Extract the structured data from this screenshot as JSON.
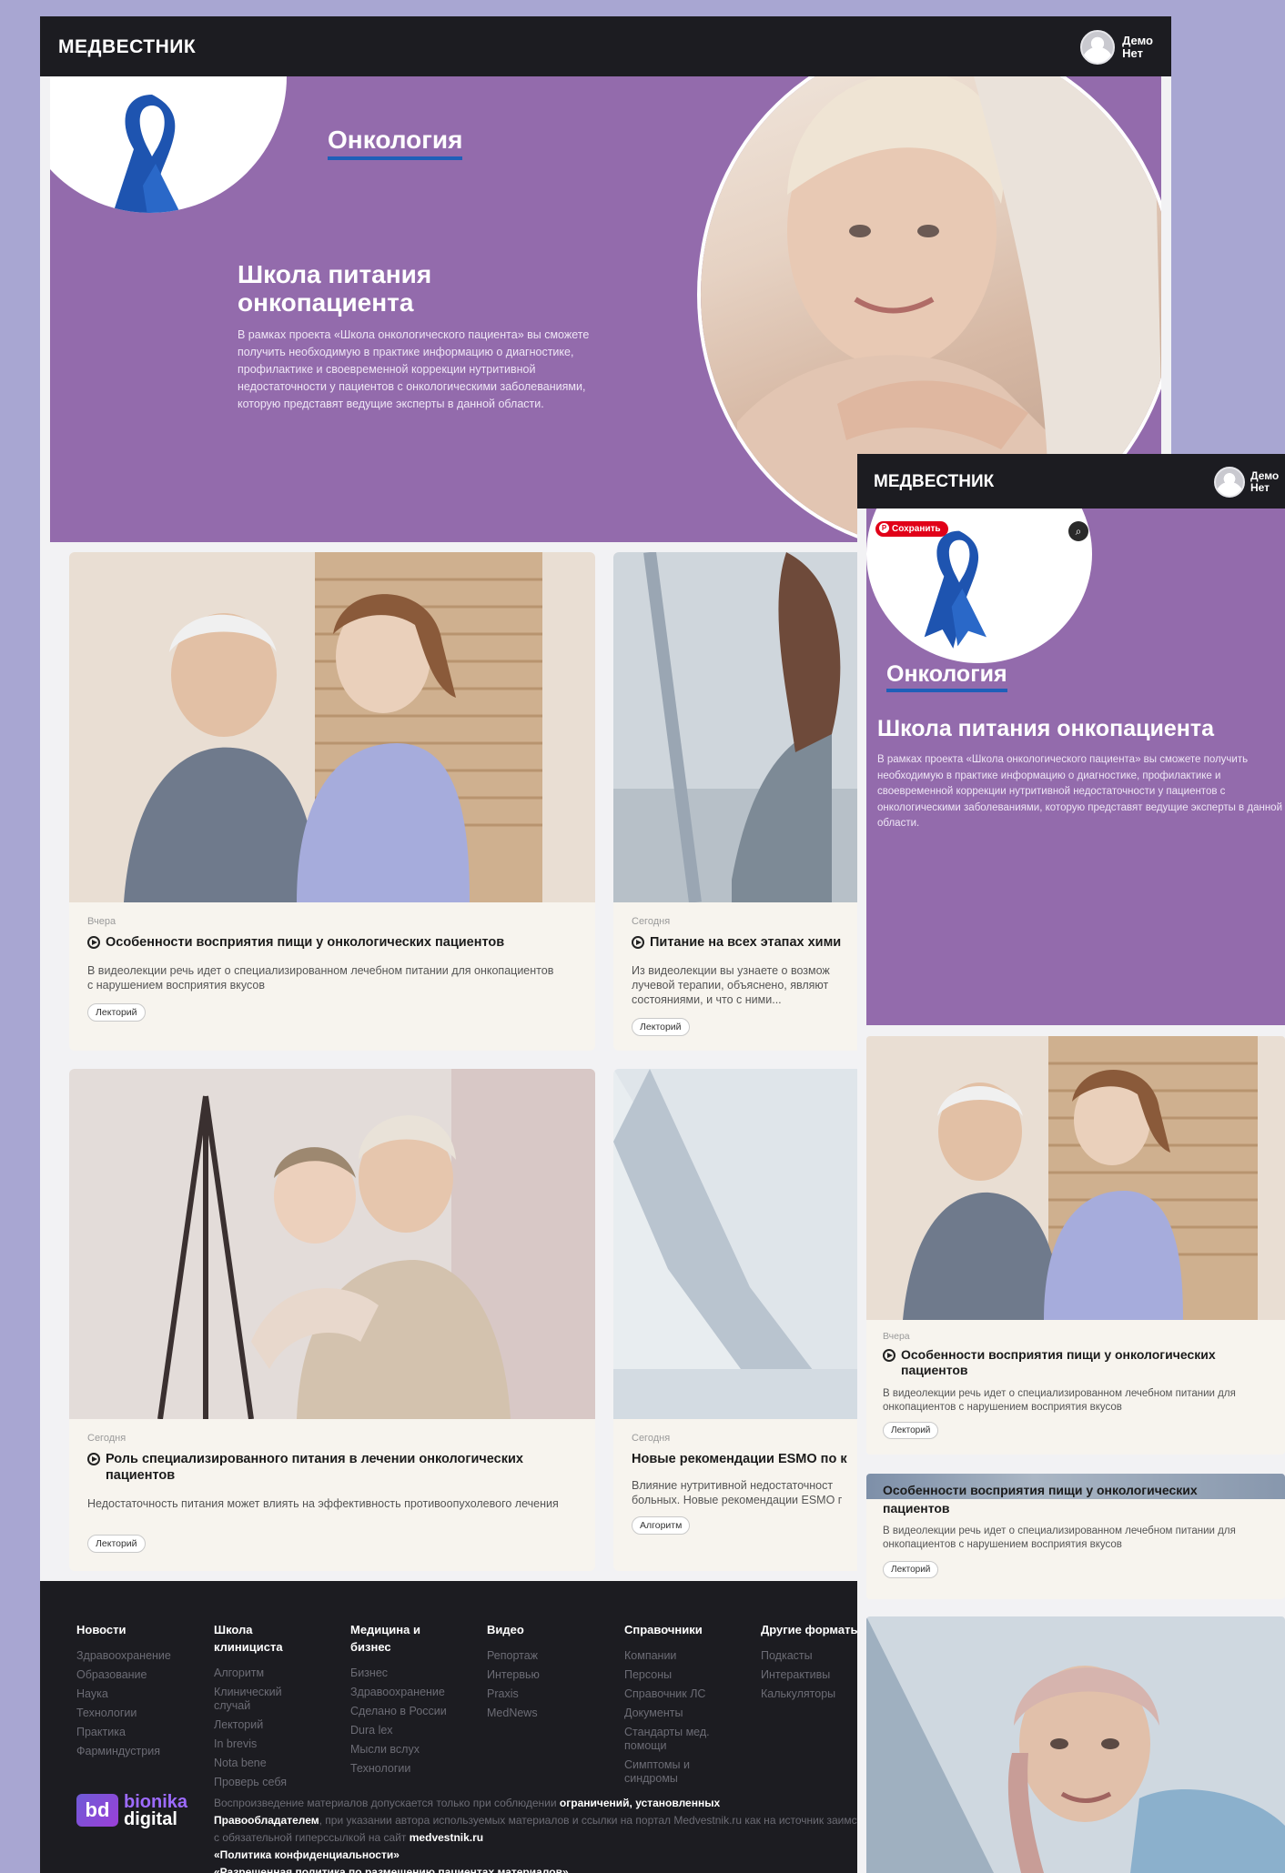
{
  "brand": "МЕДВЕСТНИК",
  "user": {
    "line1": "Демо",
    "line2": "Нет"
  },
  "hero": {
    "tag": "Онкология",
    "title": "Школа питания онкопациента",
    "description": "В рамках проекта «Школа онкологического пациента» вы сможете получить необходимую в практике информацию о диагностике, профилактике и своевременной коррекции нутритивной недостаточности у пациентов с онкологическими заболеваниями, которую представят ведущие эксперты в данной области."
  },
  "cards": [
    {
      "date": "Вчера",
      "title": "Особенности восприятия пищи у онкологических пациентов",
      "description": "В видеолекции речь идет о специализированном лечебном питании для онкопациентов с нарушением восприятия вкусов",
      "tag": "Лекторий"
    },
    {
      "date": "Сегодня",
      "title": "Питание на всех этапах хими",
      "description": "Из видеолекции вы узнаете о возмож лучевой терапии, объяснено, являют состояниями, и что с ними...",
      "tag": "Лекторий"
    },
    {
      "date": "Сегодня",
      "title": "Роль специализированного питания в лечении онкологических пациентов",
      "description": "Недостаточность питания может влиять на эффективность противоопухолевого лечения",
      "tag": "Лекторий"
    },
    {
      "date": "Сегодня",
      "title": "Новые рекомендации ESMO по к",
      "description": "Влияние нутритивной недостаточност больных. Новые рекомендации ESMO г",
      "tag": "Алгоритм"
    }
  ],
  "footer": {
    "columns": [
      {
        "head": "Новости",
        "links": [
          "Здравоохранение",
          "Образование",
          "Наука",
          "Технологии",
          "Практика",
          "Фарминдустрия"
        ]
      },
      {
        "head": "Школа клинициста",
        "links": [
          "Алгоритм",
          "Клинический случай",
          "Лекторий",
          "In brevis",
          "Nota bene",
          "Проверь себя"
        ]
      },
      {
        "head": "Медицина и бизнес",
        "links": [
          "Бизнес",
          "Здравоохранение",
          "Сделано в России",
          "Dura lex",
          "Мысли вслух",
          "Технологии"
        ]
      },
      {
        "head": "Видео",
        "links": [
          "Репортаж",
          "Интервью",
          "Praxis",
          "MedNews"
        ]
      },
      {
        "head": "Справочники",
        "links": [
          "Компании",
          "Персоны",
          "Справочник ЛС",
          "Документы",
          "Стандарты мед. помощи",
          "Симптомы и синдромы"
        ]
      },
      {
        "head": "Другие форматы",
        "links": [
          "Подкасты",
          "Интерактивы",
          "Калькуляторы"
        ]
      }
    ],
    "logo_line1": "bionika",
    "logo_line2": "digital",
    "logo_mark": "bd",
    "legal_1": "Воспроизведение материалов допускается только при соблюдении",
    "legal_1b": "ограничений, установленных",
    "legal_2b": "Правообладателем",
    "legal_2": ", при указании автора используемых материалов и ссылки на портал Medvestnik.ru как на источник заимствования с обязательной гиперссылкой на сайт",
    "legal_site": "medvestnik.ru",
    "legal_3": "«Политика конфиденциальности»",
    "legal_4": "«Разрешенная политика по размещению пациентах материалов»"
  },
  "mobile": {
    "save_label": "Сохранить",
    "lens": "⌕",
    "cards": [
      {
        "date": "Вчера",
        "title": "Особенности восприятия пищи у онкологических пациентов",
        "description": "В видеолекции речь идет о специализированном лечебном питании для онкопациентов с нарушением восприятия вкусов",
        "tag": "Лекторий"
      },
      {
        "title_tail": "пациентов",
        "title_cut": "Особенности восприятия пищи у онкологических",
        "description": "В видеолекции речь идет о специализированном лечебном питании для онкопациентов с нарушением восприятия вкусов",
        "tag": "Лекторий"
      }
    ]
  },
  "colors": {
    "hero": "#936bac",
    "dark": "#1c1c21",
    "accent": "#1f5fb8",
    "page": "#a8a6d2"
  }
}
